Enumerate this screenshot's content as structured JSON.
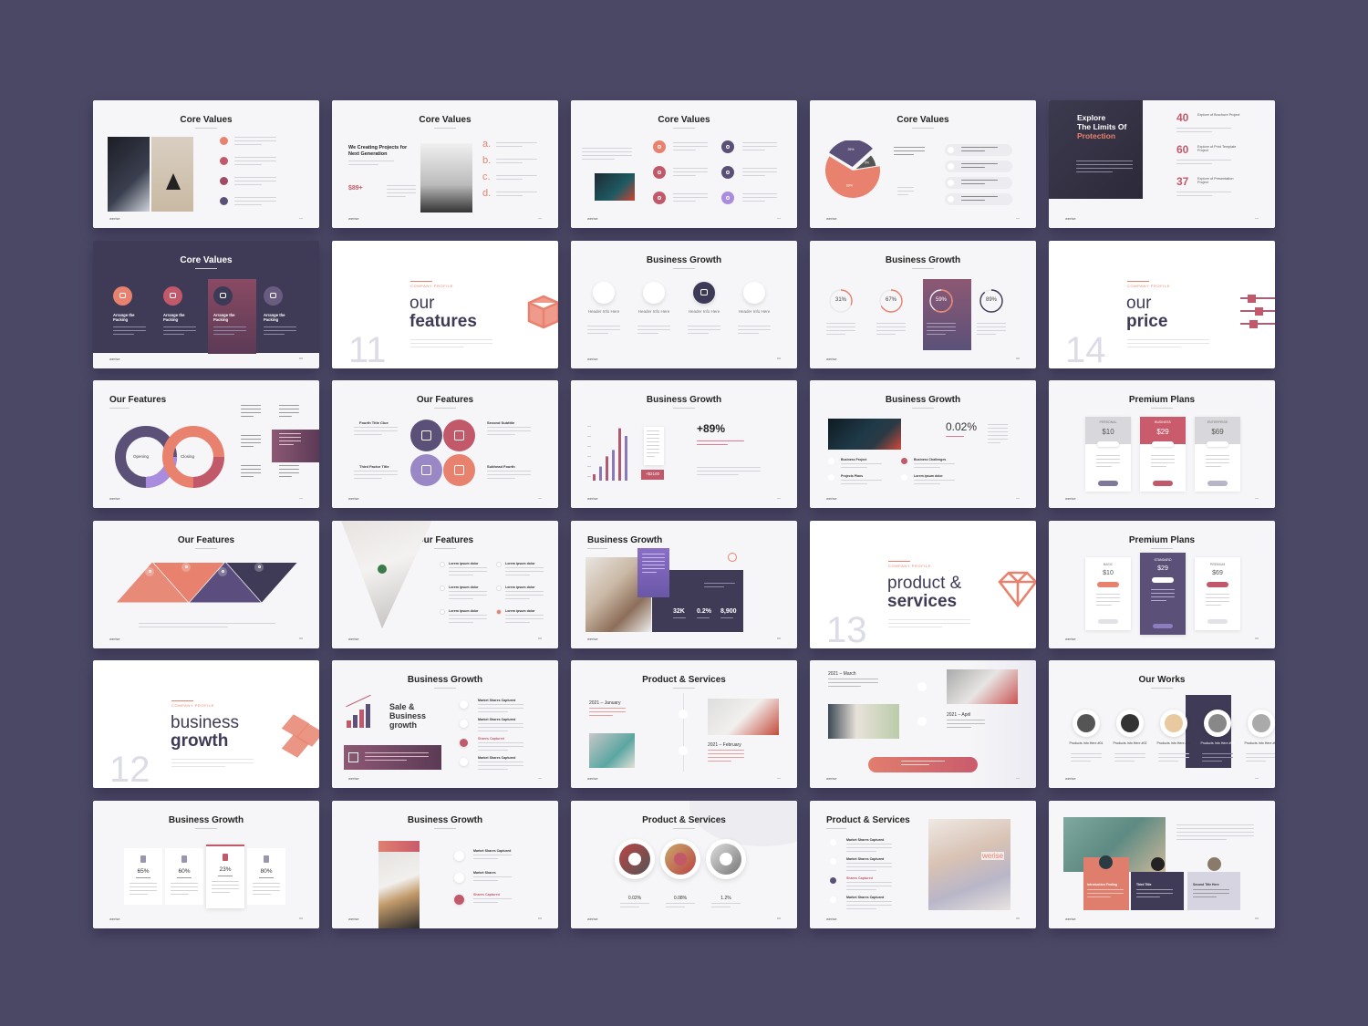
{
  "brand": {
    "logo": "werise"
  },
  "colors": {
    "background": "#4b4866",
    "coral": "#e8826e",
    "rose": "#c2596b",
    "purple": "#5b5178",
    "dark": "#3f3b57",
    "slide": "#f6f6f8"
  },
  "slides": [
    {
      "kind": "values-photos",
      "title": "Core Values"
    },
    {
      "kind": "values-text",
      "title": "Core Values",
      "heading": "We Creating Projects for Next Generation",
      "price": "$89+",
      "letters": [
        "a.",
        "b.",
        "c.",
        "d."
      ]
    },
    {
      "kind": "values-icons",
      "title": "Core Values"
    },
    {
      "kind": "pie",
      "title": "Core Values",
      "slices": [
        {
          "label": "60%",
          "value": 60
        },
        {
          "label": "29%",
          "value": 29
        },
        {
          "label": "9%",
          "value": 9
        }
      ]
    },
    {
      "kind": "explore",
      "heading": [
        "Explore",
        "The Limits Of",
        "Protection"
      ],
      "stats": [
        {
          "value": "40",
          "label": "Explore of Brochure Project"
        },
        {
          "value": "60",
          "label": "Explore of Print Template Project"
        },
        {
          "value": "37",
          "label": "Explore of Presentation Project"
        }
      ]
    },
    {
      "kind": "cards-dark",
      "title": "Core Values",
      "cards": [
        "Arrange the Packing",
        "Arrange the Packing",
        "Arrange the Packing",
        "Arrange the Packing"
      ]
    },
    {
      "kind": "section",
      "label": "COMPANY PROFILE",
      "light": "our",
      "bold": "features",
      "number": "11",
      "icon": "cube-icon"
    },
    {
      "kind": "icons-row",
      "title": "Business Growth",
      "items": [
        "Header Info Here",
        "Header Info Here",
        "Header Info Here",
        "Header Info Here"
      ]
    },
    {
      "kind": "rings",
      "title": "Business Growth",
      "items": [
        {
          "label": "31%",
          "value": 31
        },
        {
          "label": "67%",
          "value": 67
        },
        {
          "label": "59%",
          "value": 59
        },
        {
          "label": "89%",
          "value": 89
        }
      ]
    },
    {
      "kind": "section",
      "label": "COMPANY PROFILE",
      "light": "our",
      "bold": "price",
      "number": "14",
      "icon": "sliders-icon"
    },
    {
      "kind": "ring-chart",
      "title": "Our Features",
      "labels": [
        "Opening",
        "Closing"
      ]
    },
    {
      "kind": "circles-grid",
      "title": "Our Features",
      "labels": [
        "Fourth Title Clue",
        "Third Factor Title",
        "Second Subtitle",
        "Subhead Fourth"
      ]
    },
    {
      "kind": "bars",
      "title": "Business Growth",
      "big": "+89%",
      "badge": "+$2100",
      "values": [
        10,
        22,
        38,
        48,
        82,
        70
      ]
    },
    {
      "kind": "photo-stat",
      "title": "Business Growth",
      "stat": "0.02%",
      "items": [
        "Business Project",
        "Business Challenges",
        "Projects Plans",
        "Lorem ipsum dolor"
      ]
    },
    {
      "kind": "plans",
      "title": "Premium Plans",
      "featured": 1,
      "style": "top",
      "plans": [
        {
          "name": "PERSONAL",
          "price": "$10"
        },
        {
          "name": "BUSINESS",
          "price": "$29"
        },
        {
          "name": "ENTERPRISE",
          "price": "$69"
        }
      ]
    },
    {
      "kind": "triangles",
      "title": "Our Features"
    },
    {
      "kind": "triangle-photo",
      "title": "Our Features",
      "items": [
        "Lorem ipsum dolor",
        "Lorem ipsum dolor",
        "Lorem ipsum dolor",
        "Lorem ipsum dolor",
        "Lorem ipsum dolor",
        "Lorem ipsum dolor"
      ]
    },
    {
      "kind": "photo-panel",
      "title": "Business Growth",
      "stats": [
        "32K",
        "0.2%",
        "8,900"
      ]
    },
    {
      "kind": "section",
      "label": "COMPANY PROFILE",
      "light": "product &",
      "bold": "services",
      "number": "13",
      "icon": "diamond-icon"
    },
    {
      "kind": "plans",
      "title": "Premium Plans",
      "featured": 1,
      "style": "tall",
      "plans": [
        {
          "name": "BASIC",
          "price": "$10"
        },
        {
          "name": "STANDARD",
          "price": "$29"
        },
        {
          "name": "PREMIUM",
          "price": "$69"
        }
      ]
    },
    {
      "kind": "section",
      "label": "COMPANY PROFILE",
      "light": "business",
      "bold": "growth",
      "number": "12",
      "icon": "cubes-icon"
    },
    {
      "kind": "sale",
      "title": "Business Growth",
      "heading": [
        "Sale &",
        "Business",
        "growth"
      ],
      "items": [
        "Market Shares Captured",
        "Market Shares Captured",
        "Shares Captured",
        "Market Shares Captured"
      ]
    },
    {
      "kind": "timeline",
      "title": "Product & Services",
      "dates": [
        "2021 – January",
        "2021 – February"
      ]
    },
    {
      "kind": "timeline2",
      "dates": [
        "2021 – March",
        "2021 – April"
      ]
    },
    {
      "kind": "works",
      "title": "Our Works",
      "featured": 3,
      "items": [
        "Products Info Here #01",
        "Products Info Here #02",
        "Products Info Here #03",
        "Products Info Here #04",
        "Products Info Here #05"
      ]
    },
    {
      "kind": "stat-cards",
      "title": "Business Growth",
      "featured": 2,
      "values": [
        "65%",
        "60%",
        "23%",
        "80%"
      ]
    },
    {
      "kind": "photo-list",
      "title": "Business Growth",
      "items": [
        "Market Shares Captured",
        "Market Shares",
        "Shares Captured"
      ]
    },
    {
      "kind": "photo-circles",
      "title": "Product & Services",
      "values": [
        "0.02%",
        "0.08%",
        "1.2%"
      ]
    },
    {
      "kind": "list-photo-right",
      "title": "Product & Services",
      "watermark": "werise",
      "items": [
        "Market Shares Captured",
        "Market Shares Captured",
        "Shares Captured",
        "Market Shares Captured"
      ]
    },
    {
      "kind": "mosaic",
      "labels": [
        "Introduction Finding",
        "Third Title",
        "Second Title Here"
      ]
    }
  ]
}
